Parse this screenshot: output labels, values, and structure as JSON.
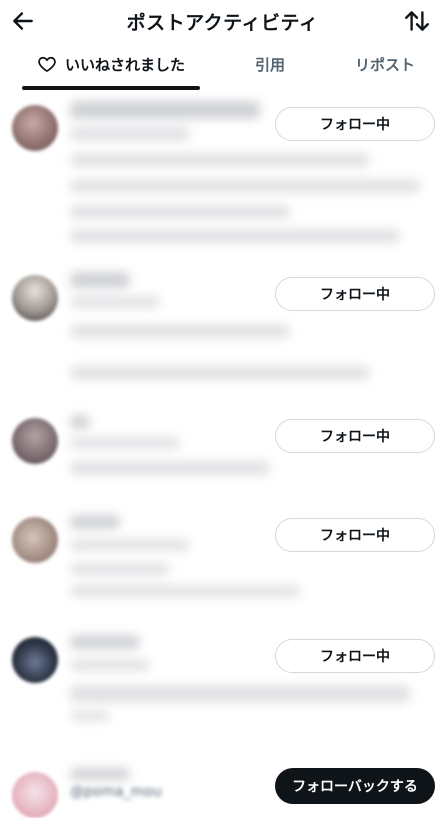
{
  "header": {
    "title": "ポストアクティビティ",
    "back_icon": "arrow-left-icon",
    "sort_icon": "sort-arrows-icon"
  },
  "tabs": [
    {
      "label": "いいねされました",
      "icon": "heart-icon",
      "active": true
    },
    {
      "label": "引用",
      "active": false
    },
    {
      "label": "リポスト",
      "active": false
    }
  ],
  "users": [
    {
      "follow_label": "フォロー中"
    },
    {
      "follow_label": "フォロー中"
    },
    {
      "follow_label": "フォロー中"
    },
    {
      "follow_label": "フォロー中"
    },
    {
      "follow_label": "フォロー中"
    },
    {
      "follow_label": "フォローバックする",
      "handle": "@poma_mou"
    }
  ],
  "colors": {
    "text": "#0f1419",
    "secondary": "#536471",
    "button_border": "#cfd9de",
    "dark_button": "#0f1419"
  }
}
